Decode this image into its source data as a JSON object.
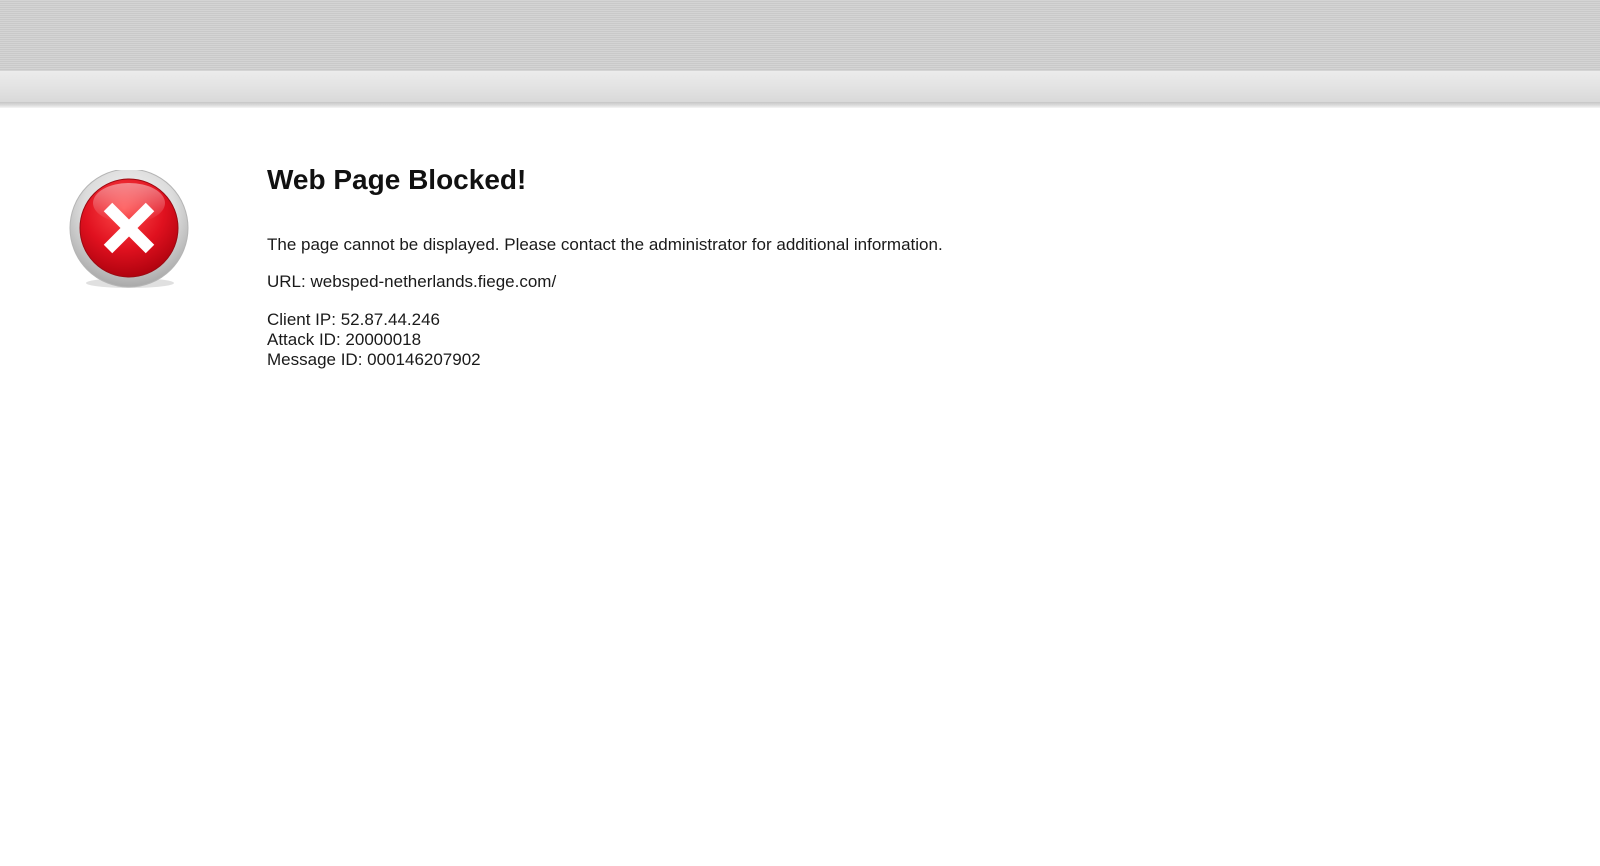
{
  "page": {
    "title": "Web Page Blocked!",
    "message": "The page cannot be displayed. Please contact the administrator for additional information.",
    "url_label": "URL:",
    "url_value": "websped-netherlands.fiege.com/",
    "details": [
      {
        "label": "Client IP:",
        "value": "52.87.44.246"
      },
      {
        "label": "Attack ID:",
        "value": "20000018"
      },
      {
        "label": "Message ID:",
        "value": "000146207902"
      }
    ]
  },
  "icon": {
    "name": "error-x-icon"
  },
  "colors": {
    "header_band": "#cfcfcf",
    "error_red": "#d90f1c",
    "ring_silver": "#d8d8d8",
    "text": "#1a1a1a",
    "background": "#ffffff"
  }
}
